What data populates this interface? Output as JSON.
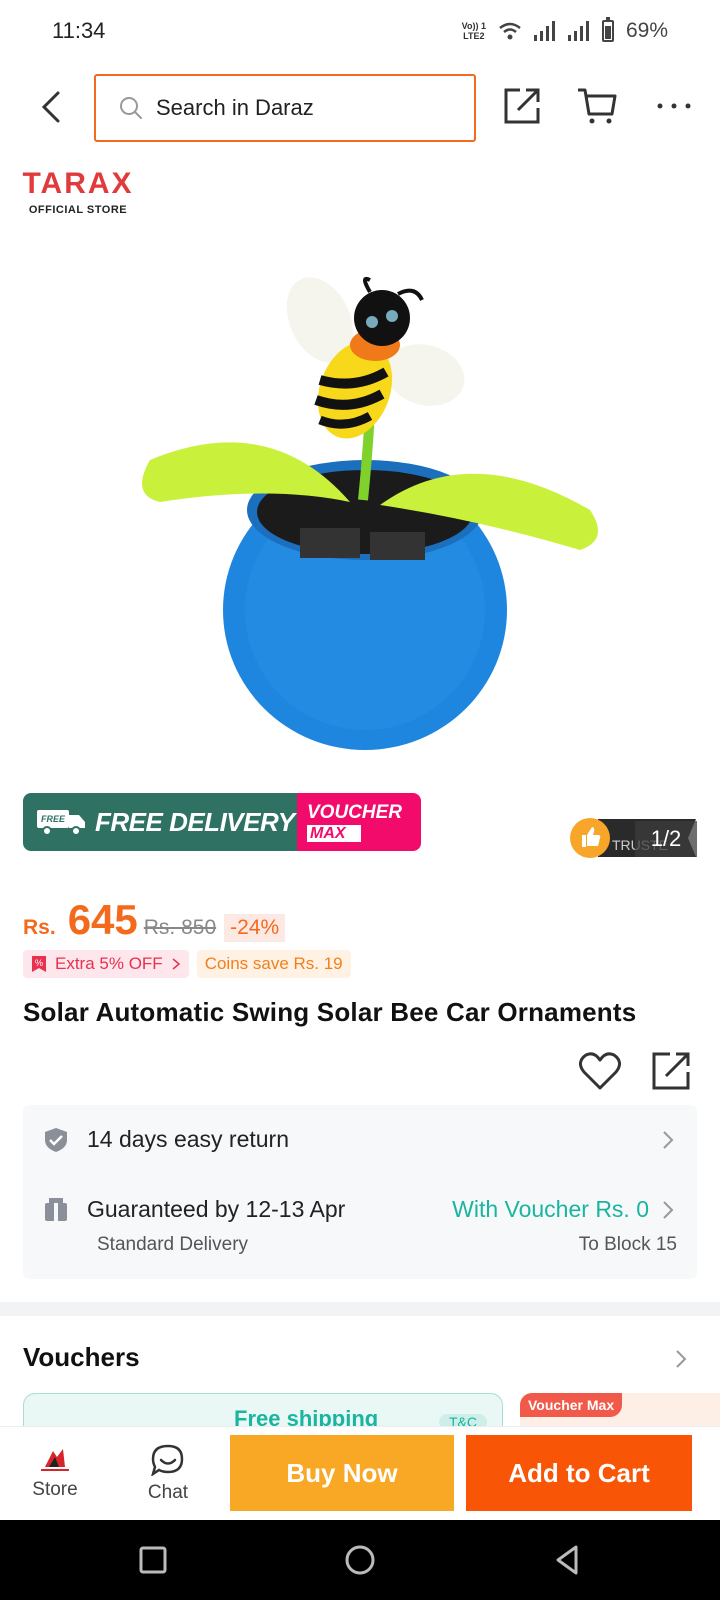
{
  "status_bar": {
    "time": "11:34",
    "volte_line1": "Vo)) 1",
    "volte_line2": "LTE2",
    "battery": "69%"
  },
  "header": {
    "search_placeholder": "Search in Daraz"
  },
  "store": {
    "name": "TARAX",
    "subtitle": "OFFICIAL STORE"
  },
  "gallery": {
    "counter": "1/2",
    "trusted_label": "TRUSTE"
  },
  "promo": {
    "delivery_label": "FREE DELIVERY",
    "free_tag": "FREE",
    "voucher_line1": "VOUCHER",
    "voucher_line2": "MAX"
  },
  "price": {
    "currency": "Rs.",
    "current": "645",
    "original": "Rs. 850",
    "discount": "-24%"
  },
  "tags": {
    "extra": "Extra 5% OFF",
    "coins": "Coins save Rs. 19"
  },
  "product": {
    "title": "Solar Automatic Swing Solar Bee Car Ornaments"
  },
  "services": {
    "return_text": "14 days easy return",
    "delivery_text": "Guaranteed by 12-13 Apr",
    "delivery_voucher": "With Voucher Rs. 0",
    "delivery_method": "Standard Delivery",
    "delivery_location": "To Block 15"
  },
  "vouchers": {
    "title": "Vouchers",
    "card_text": "Free shipping",
    "card_tc": "T&C",
    "card2_tag": "Voucher Max"
  },
  "bottom_bar": {
    "store_label": "Store",
    "chat_label": "Chat",
    "buy_now": "Buy Now",
    "add_to_cart": "Add to Cart"
  },
  "colors": {
    "accent": "#f85606",
    "buy_now": "#f9a825",
    "teal": "#19b5a0",
    "promo_green": "#2f7264",
    "promo_pink": "#f20b6a"
  }
}
